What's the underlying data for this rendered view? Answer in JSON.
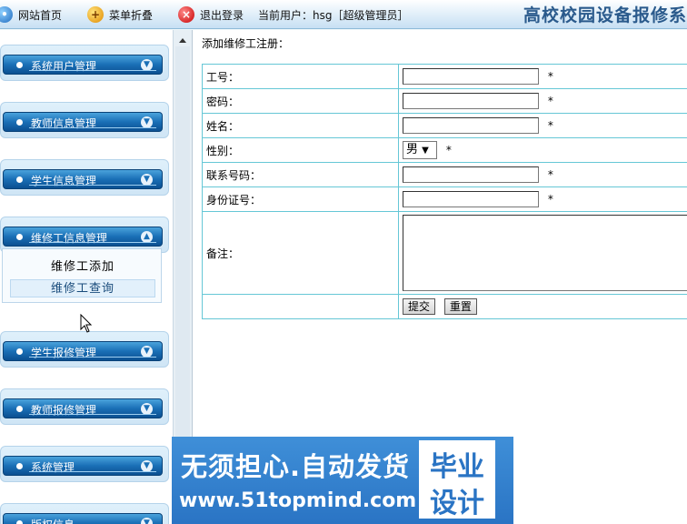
{
  "topbar": {
    "home": "网站首页",
    "fold_menu": "菜单折叠",
    "logout": "退出登录",
    "current_user": "当前用户：hsg［超级管理员］",
    "site_title": "高校校园设备报修系统"
  },
  "sidebar": {
    "menus": [
      "系统用户管理",
      "教师信息管理",
      "学生信息管理",
      "维修工信息管理",
      "学生报修管理",
      "教师报修管理",
      "系统管理",
      "版权信息"
    ],
    "submenu": [
      "维修工添加",
      "维修工查询"
    ]
  },
  "form": {
    "title": "添加维修工注册：",
    "fields": {
      "worker_id": "工号：",
      "password": "密码：",
      "name": "姓名：",
      "gender": "性别：",
      "phone": "联系号码：",
      "id_card": "身份证号：",
      "remark": "备注："
    },
    "gender_value": "男",
    "required_mark": "*",
    "submit": "提交",
    "reset": "重置"
  },
  "watermark": {
    "line1": "无须担心.自动发货",
    "line2": "www.51topmind.com",
    "box_top": "毕业",
    "box_bottom": "设计"
  }
}
